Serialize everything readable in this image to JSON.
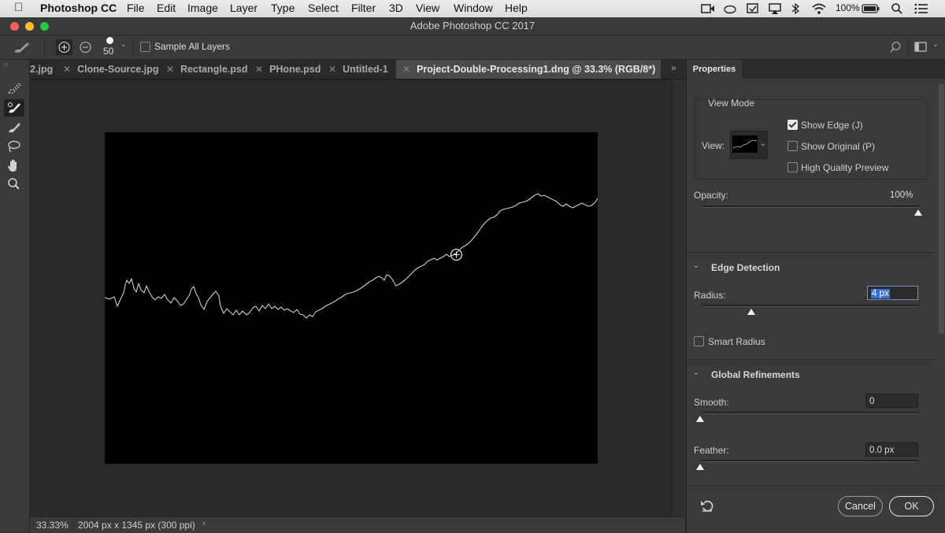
{
  "menubar": {
    "app_name": "Photoshop CC",
    "items": [
      "File",
      "Edit",
      "Image",
      "Layer",
      "Type",
      "Select",
      "Filter",
      "3D",
      "View",
      "Window",
      "Help"
    ],
    "battery": "100%"
  },
  "window": {
    "title": "Adobe Photoshop CC 2017"
  },
  "options": {
    "brush_size": "50",
    "sample_all_layers": "Sample All Layers"
  },
  "tabs": [
    {
      "label": "2.jpg"
    },
    {
      "label": "Clone-Source.jpg"
    },
    {
      "label": "Rectangle.psd"
    },
    {
      "label": "PHone.psd"
    },
    {
      "label": "Untitled-1"
    },
    {
      "label": "Project-Double-Processing1.dng @ 33.3% (RGB/8*)"
    }
  ],
  "status": {
    "zoom": "33.33%",
    "doc_info": "2004 px x 1345 px (300 ppi)"
  },
  "panel": {
    "tab": "Properties",
    "view_mode": {
      "heading": "View Mode",
      "view_label": "View:",
      "show_edge": "Show Edge (J)",
      "show_original": "Show Original (P)",
      "high_quality": "High Quality Preview",
      "show_edge_checked": true
    },
    "opacity": {
      "label": "Opacity:",
      "value": "100%",
      "level": 1.0
    },
    "edge_detection": {
      "heading": "Edge Detection",
      "radius_label": "Radius:",
      "radius_value": "4 px",
      "radius_level": 0.2,
      "smart_radius": "Smart Radius"
    },
    "global_refinements": {
      "heading": "Global Refinements",
      "smooth_label": "Smooth:",
      "smooth_value": "0",
      "feather_label": "Feather:",
      "feather_value": "0.0 px"
    },
    "buttons": {
      "cancel": "Cancel",
      "ok": "OK"
    }
  }
}
